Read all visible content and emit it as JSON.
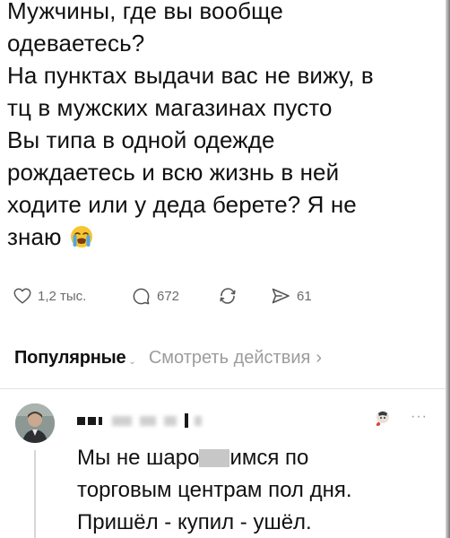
{
  "post": {
    "lines": [
      "Мужчины, где вы вообще",
      "одеваетесь?",
      "На пунктах выдачи вас не вижу, в",
      "тц в мужских магазинах пусто",
      "Вы типа в одной одежде",
      "рождаетесь и всю жизнь в ней",
      "ходите или у деда берете? Я не",
      "знаю"
    ],
    "emoji": "loudly-crying-face"
  },
  "actions": {
    "likes": "1,2 тыс.",
    "comments": "672",
    "reposts": "",
    "shares": "61"
  },
  "tabs": {
    "popular": "Популярные",
    "view_activity": "Смотреть действия"
  },
  "reply": {
    "line1_before": "Мы не шаро",
    "line1_after": "имся по",
    "line2": "торговым центрам пол дня.",
    "line3": "Пришёл - купил - ушёл."
  },
  "icons": {
    "like": "heart-outline-icon",
    "comment": "speech-bubble-icon",
    "repost": "repost-arrows-icon",
    "share": "send-icon",
    "more": "more-dots-icon"
  },
  "colors": {
    "text": "#111111",
    "muted": "#6b6b6b",
    "divider": "#e3e3e3"
  }
}
